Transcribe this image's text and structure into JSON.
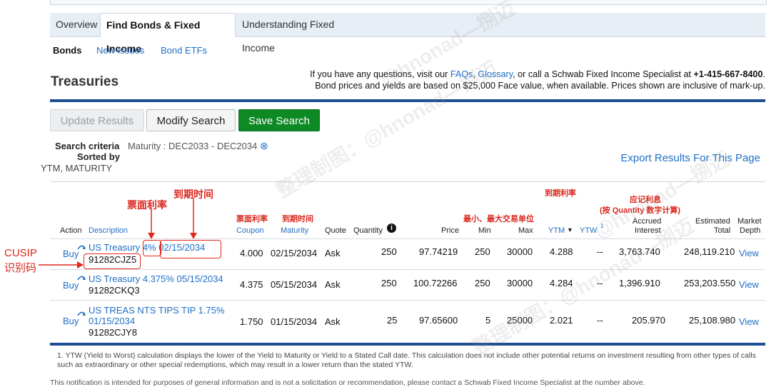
{
  "tabs": [
    "Overview",
    "Find Bonds & Fixed Income",
    "Understanding Fixed Income"
  ],
  "subnav": [
    "Bonds",
    "New Issues",
    "Bond ETFs"
  ],
  "page_title": "Treasuries",
  "help": {
    "line1_pre": "If you have any questions, visit our ",
    "faqs": "FAQs",
    "comma": ", ",
    "glossary": "Glossary",
    "line1_mid": ", or call a Schwab Fixed Income Specialist at ",
    "phone": "+1-415-667-8400",
    "line1_end": ".",
    "line2": "Bond prices and yields are based on $25,000 Face value, when available. Prices shown are inclusive of mark-up."
  },
  "buttons": {
    "update": "Update Results",
    "modify": "Modify Search",
    "save": "Save Search"
  },
  "criteria": {
    "label1": "Search criteria",
    "value1": "Maturity : DEC2033 - DEC2034",
    "clear_icon": "⊗",
    "label2": "Sorted by",
    "value2": "YTM, MATURITY"
  },
  "export": "Export Results For This Page",
  "annotations": {
    "coupon_big": "票面利率",
    "maturity_big": "到期时间",
    "ytm_cn": "到期利率",
    "accrued_cn1": "应记利息",
    "accrued_cn2": "(按 Quantity 数字计算)",
    "coupon_small": "票面利率",
    "maturity_small": "到期时间",
    "minmax_cn": "最小、最大交易单位",
    "cusip1": "CUSIP",
    "cusip2": "识别码"
  },
  "headers": {
    "action": "Action",
    "description": "Description",
    "coupon": "Coupon",
    "maturity": "Maturity",
    "quote": "Quote",
    "quantity": "Quantity",
    "info_icon": "i",
    "price": "Price",
    "min": "Min",
    "max": "Max",
    "ytm": "YTM",
    "ytm_sort": "▼",
    "ytw": "YTW",
    "ytw_sup": "1",
    "accrued1": "Accrued",
    "accrued2": "Interest",
    "estimated1": "Estimated",
    "estimated2": "Total",
    "market1": "Market",
    "market2": "Depth"
  },
  "rows": [
    {
      "action": "Buy",
      "desc1": "US Treasury",
      "desc_rate": "4%",
      "desc_date": "02/15/2034",
      "desc3": "",
      "cusip": "91282CJZ5",
      "coupon": "4.000",
      "maturity": "02/15/2034",
      "quote": "Ask",
      "quantity": "250",
      "price": "97.74219",
      "min": "250",
      "max": "30000",
      "ytm": "4.288",
      "ytw": "--",
      "accrued": "3,763.740",
      "total": "248,119.210",
      "view": "View"
    },
    {
      "action": "Buy",
      "desc1": "US Treasury 4.375% 05/15/2034",
      "desc_rate": "",
      "desc_date": "",
      "desc3": "",
      "cusip": "91282CKQ3",
      "coupon": "4.375",
      "maturity": "05/15/2034",
      "quote": "Ask",
      "quantity": "250",
      "price": "100.72266",
      "min": "250",
      "max": "30000",
      "ytm": "4.284",
      "ytw": "--",
      "accrued": "1,396.910",
      "total": "253,203.550",
      "view": "View"
    },
    {
      "action": "Buy",
      "desc1": "US TREAS NTS TIPS TIP 1.75%",
      "desc_rate": "",
      "desc_date": "",
      "desc3": "01/15/2034",
      "cusip": "91282CJY8",
      "coupon": "1.750",
      "maturity": "01/15/2034",
      "quote": "Ask",
      "quantity": "25",
      "price": "97.65600",
      "min": "5",
      "max": "25000",
      "ytm": "2.021",
      "ytw": "--",
      "accrued": "205.970",
      "total": "25,108.980",
      "view": "View"
    }
  ],
  "footnote": "1. YTW (Yield to Worst) calculation displays the lower of the Yield to Maturity or Yield to a Stated Call date. This calculation does not include other potential returns on investment resulting from other types of calls such as extraordinary or other special redemptions, which may result in a lower return than the stated YTW.",
  "footnote2": "This notification is intended for purposes of general information and is not a solicitation or recommendation, please contact a Schwab Fixed Income Specialist at the number above.",
  "watermarks": [
    "@hnonad—捌迈",
    "整理制图：@hnonad—捌迈",
    "@hnonad—捌迈",
    "整理制图：@hnonad—捌迈"
  ],
  "colors": {
    "link": "#1f6fc5",
    "save": "#0e8a25",
    "annotation": "#d9281e",
    "rule": "#1c4f91"
  }
}
